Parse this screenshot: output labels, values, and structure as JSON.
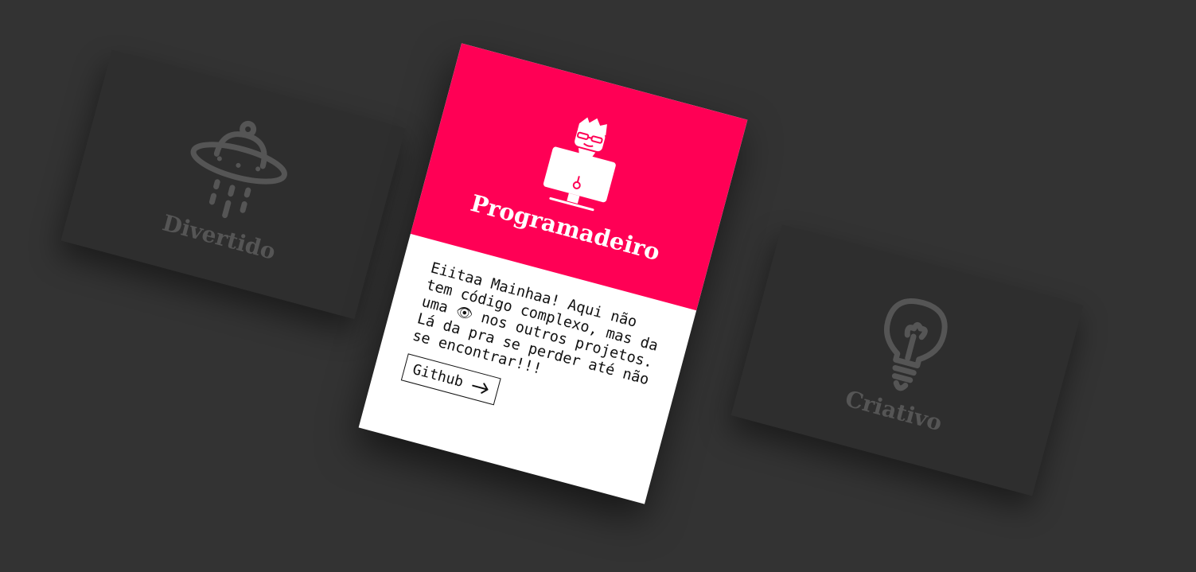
{
  "cards": {
    "left": {
      "label": "Divertido",
      "icon": "ufo-icon"
    },
    "center": {
      "title": "Programadeiro",
      "icon": "programmer-computer-icon",
      "description_line1": "Eiitaa Mainhaa! Aqui não tem código complexo, mas da uma ",
      "eye_icon": "👁",
      "description_line2": " nos outros projetos. Lá da pra se perder até não se encontrar!!!",
      "button_label": "Github",
      "button_icon": "arrow-right-icon"
    },
    "right": {
      "label": "Criativo",
      "icon": "lightbulb-icon"
    }
  },
  "colors": {
    "background": "#333333",
    "card_inactive": "#2e2e2e",
    "inactive_content": "#555555",
    "accent": "#ff0055",
    "card_body": "#ffffff",
    "text": "#111111"
  }
}
